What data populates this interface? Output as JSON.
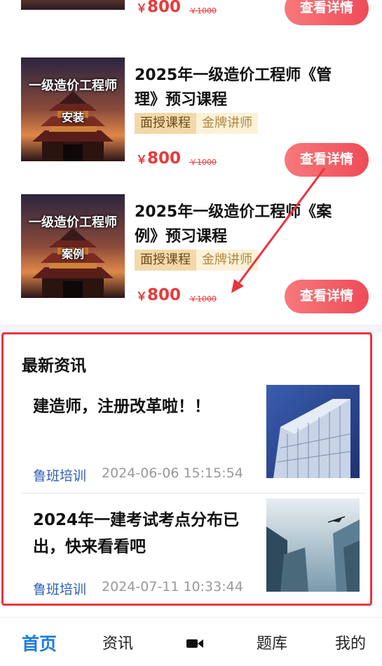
{
  "courses": [
    {
      "thumb_line1": "",
      "thumb_line2": "",
      "title": "",
      "tag1": "",
      "tag2": "",
      "currency": "￥",
      "price": "800",
      "original_price": "￥1000",
      "button": "查看详情"
    },
    {
      "thumb_line1": "一级造价工程师",
      "thumb_line2": "安装",
      "title": "2025年一级造价工程师《管理》预习课程",
      "tag1": "面授课程",
      "tag2": "金牌讲师",
      "currency": "￥",
      "price": "800",
      "original_price": "￥1000",
      "button": "查看详情"
    },
    {
      "thumb_line1": "一级造价工程师",
      "thumb_line2": "案例",
      "title": "2025年一级造价工程师《案例》预习课程",
      "tag1": "面授课程",
      "tag2": "金牌讲师",
      "currency": "￥",
      "price": "800",
      "original_price": "￥1000",
      "button": "查看详情"
    }
  ],
  "news": {
    "section_title": "最新资讯",
    "items": [
      {
        "title": "建造师，注册改革啦！！",
        "source": "鲁班培训",
        "time": "2024-06-06 15:15:54"
      },
      {
        "title": "2024年一建考试考点分布已出，快来看看吧",
        "source": "鲁班培训",
        "time": "2024-07-11 10:33:44"
      }
    ]
  },
  "tabbar": {
    "home": "首页",
    "news": "资讯",
    "video_icon": "video-camera-icon",
    "questions": "题库",
    "mine": "我的"
  },
  "colors": {
    "accent_red": "#ee4b57",
    "price_red": "#e83a3a",
    "tab_active_blue": "#1b7be0",
    "source_blue": "#2d5fb8",
    "highlight_border": "#e8343f"
  }
}
